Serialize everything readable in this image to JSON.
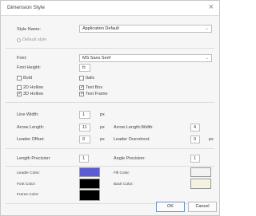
{
  "window": {
    "title": "Dimension Style",
    "close_glyph": "×"
  },
  "style_name": {
    "label": "Style Name:",
    "value": "Application Default"
  },
  "default_style": {
    "label": "Default style"
  },
  "font": {
    "label": "Font:",
    "value": "MS Sans Serif"
  },
  "font_height": {
    "label": "Font Height:",
    "value": "fc"
  },
  "checkboxes": {
    "bold": {
      "label": "Bold",
      "checked": false
    },
    "italic": {
      "label": "Italic",
      "checked": false
    },
    "hollow_2d": {
      "label": "2D Hollow",
      "checked": false
    },
    "hollow_3d": {
      "label": "3D Hollow",
      "checked": true
    },
    "text_box": {
      "label": "Text Box",
      "checked": true
    },
    "text_frame": {
      "label": "Text Frame",
      "checked": true
    }
  },
  "line_width": {
    "label": "Line Width:",
    "value": "1",
    "unit": "px"
  },
  "arrow_length": {
    "label": "Arrow Length:",
    "value": "11",
    "unit": "px"
  },
  "arrow_ratio": {
    "label": "Arrow Length:Width:",
    "value": "4"
  },
  "leader_offset": {
    "label": "Leader Offset:",
    "value": "0",
    "unit": "px"
  },
  "leader_overshoot": {
    "label": "Leader Overshoot:",
    "value": "0",
    "unit": "px"
  },
  "length_precision": {
    "label": "Length Precision:",
    "value": "1"
  },
  "angle_precision": {
    "label": "Angle Precision:",
    "value": "1"
  },
  "colors": {
    "leader_color": {
      "label": "Leader Color:",
      "hex": "#5b5bd6"
    },
    "font_color": {
      "label": "Font Color:",
      "hex": "#000000"
    },
    "frame_color": {
      "label": "Frame Color:",
      "hex": "#000000"
    },
    "fill_color": {
      "label": "Fill Color:",
      "hex": "#f3f3f3"
    },
    "back_color": {
      "label": "Back Color:",
      "hex": "#f5f3e0"
    }
  },
  "buttons": {
    "ok": "OK",
    "cancel": "Cancel"
  }
}
